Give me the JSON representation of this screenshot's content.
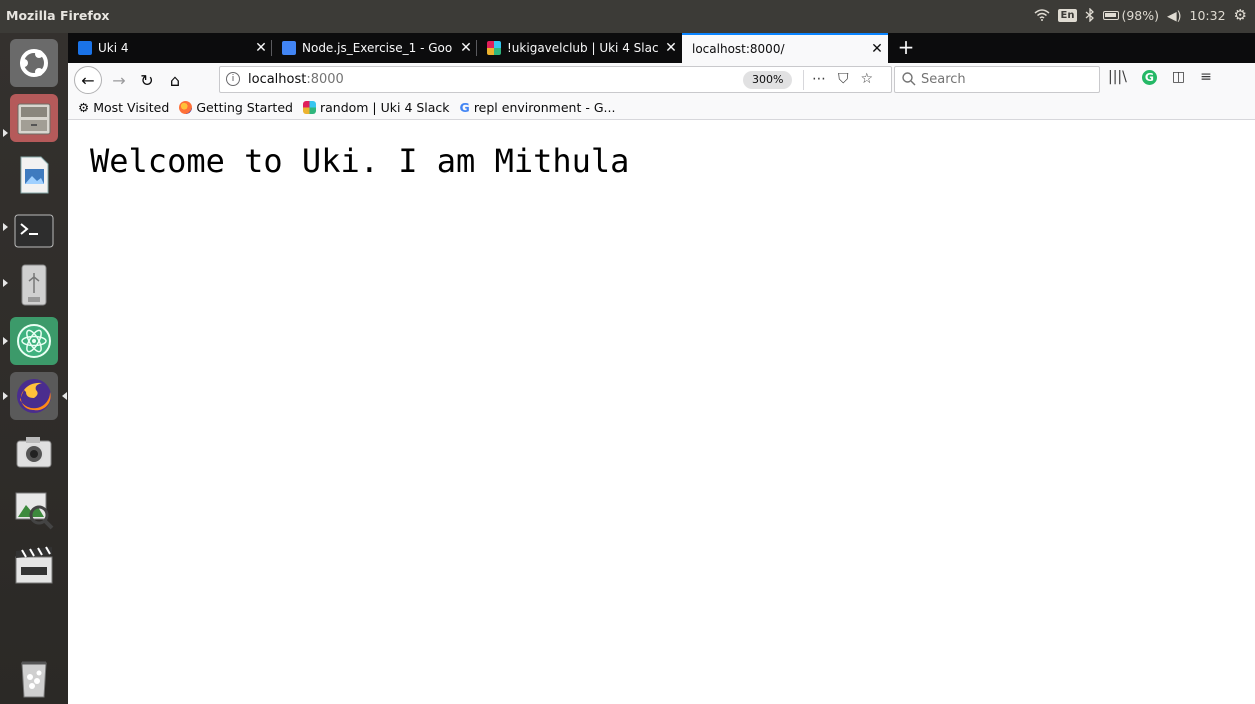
{
  "system": {
    "app_title": "Mozilla Firefox",
    "keyboard_layout": "En",
    "battery": "(98%)",
    "clock": "10:32"
  },
  "launcher": {
    "items": [
      {
        "name": "ubuntu-dash",
        "icon": "ubuntu-logo-icon"
      },
      {
        "name": "files",
        "icon": "file-cabinet-icon"
      },
      {
        "name": "libreoffice-impress",
        "icon": "document-image-icon"
      },
      {
        "name": "terminal",
        "icon": "terminal-icon"
      },
      {
        "name": "usb-drive",
        "icon": "usb-drive-icon"
      },
      {
        "name": "atom",
        "icon": "atom-icon"
      },
      {
        "name": "firefox",
        "icon": "firefox-icon"
      },
      {
        "name": "camera",
        "icon": "camera-icon"
      },
      {
        "name": "image-viewer",
        "icon": "image-viewer-icon"
      },
      {
        "name": "video-editor",
        "icon": "clapperboard-icon"
      },
      {
        "name": "trash",
        "icon": "trash-icon"
      }
    ]
  },
  "tabs": [
    {
      "label": "Uki 4",
      "icon": "slides-icon",
      "color": "#1a73e8"
    },
    {
      "label": "Node.js_Exercise_1 - Goo",
      "icon": "docs-icon",
      "color": "#4285f4"
    },
    {
      "label": "!ukigavelclub | Uki 4 Slac",
      "icon": "slack-icon",
      "color": "#611f69"
    },
    {
      "label": "localhost:8000/",
      "icon": "",
      "color": ""
    }
  ],
  "urlbar": {
    "host": "localhost",
    "port": ":8000",
    "zoom": "300%"
  },
  "search": {
    "placeholder": "Search"
  },
  "bookmarks": [
    {
      "label": "Most Visited",
      "icon": "gear-icon"
    },
    {
      "label": "Getting Started",
      "icon": "firefox-icon"
    },
    {
      "label": "random | Uki 4 Slack",
      "icon": "slack-icon"
    },
    {
      "label": "repl environment - G...",
      "icon": "google-icon"
    }
  ],
  "page": {
    "heading": "Welcome to Uki. I am Mithula"
  },
  "colors": {
    "accent": "#0a84ff",
    "tab_strip": "#0c0c0d",
    "toolbar": "#f9f9fa",
    "launcher": "#2b2926"
  }
}
